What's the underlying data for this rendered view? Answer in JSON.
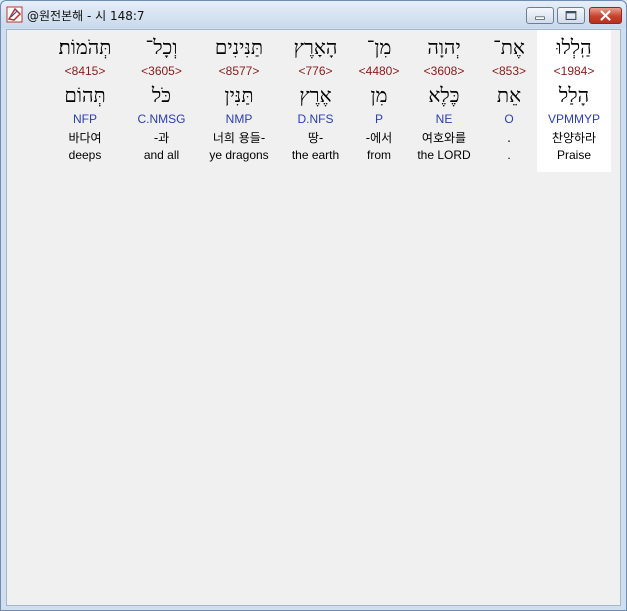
{
  "window": {
    "title": "@원전본해 - 시 148:7"
  },
  "words": [
    {
      "hebrew": "הַֽלְלוּ",
      "strong": "<1984>",
      "root": "הָלַל",
      "morph": "VPMMYP",
      "korean": "찬양하라",
      "english": "Praise"
    },
    {
      "hebrew": "אֶת־",
      "strong": "<853>",
      "root": "אֵת",
      "morph": "O",
      "korean": ".",
      "english": "."
    },
    {
      "hebrew": "יְהוָה",
      "strong": "<3608>",
      "root": "כֶּלֶא",
      "morph": "NE",
      "korean": "여호와를",
      "english": "the LORD"
    },
    {
      "hebrew": "מִן־",
      "strong": "<4480>",
      "root": "מִן",
      "morph": "P",
      "korean": "-에서",
      "english": "from"
    },
    {
      "hebrew": "הָאָרֶץ",
      "strong": "<776>",
      "root": "אֶרֶץ",
      "morph": "D.NFS",
      "korean": "땅-",
      "english": "the earth"
    },
    {
      "hebrew": "תַּנִּינִים",
      "strong": "<8577>",
      "root": "תַּנִּין",
      "morph": "NMP",
      "korean": "너희 용들-",
      "english": "ye dragons"
    },
    {
      "hebrew": "וְכָל־",
      "strong": "<3605>",
      "root": "כֹּל",
      "morph": "C.NMSG",
      "korean": "-과",
      "english": "and all"
    },
    {
      "hebrew": "תְּהֹמוֹת׃",
      "strong": "<8415>",
      "root": "תְּהוֹם",
      "morph": "NFP",
      "korean": "바다여",
      "english": "deeps"
    }
  ]
}
